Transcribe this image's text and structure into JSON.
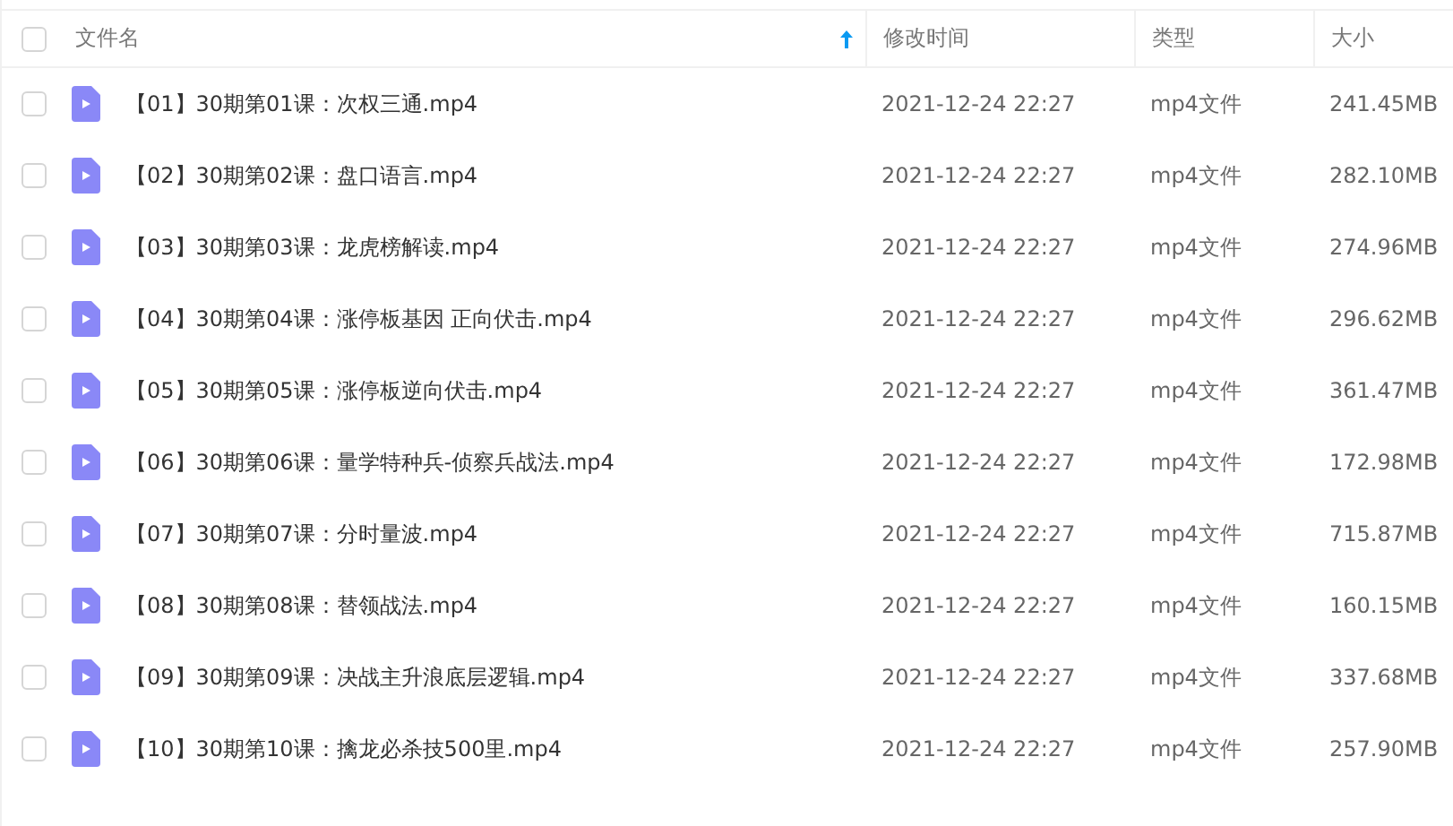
{
  "table": {
    "select_all": {
      "checked": false
    },
    "columns": [
      {
        "label": "文件名",
        "sorted": true
      },
      {
        "label": "修改时间",
        "sorted": false
      },
      {
        "label": "类型",
        "sorted": false
      },
      {
        "label": "大小",
        "sorted": false
      }
    ],
    "rows": [
      {
        "checked": false,
        "name": "【01】30期第01课：次权三通.mp4",
        "modified": "2021-12-24 22:27",
        "type": "mp4文件",
        "size": "241.45MB"
      },
      {
        "checked": false,
        "name": "【02】30期第02课：盘口语言.mp4",
        "modified": "2021-12-24 22:27",
        "type": "mp4文件",
        "size": "282.10MB"
      },
      {
        "checked": false,
        "name": "【03】30期第03课：龙虎榜解读.mp4",
        "modified": "2021-12-24 22:27",
        "type": "mp4文件",
        "size": "274.96MB"
      },
      {
        "checked": false,
        "name": "【04】30期第04课：涨停板基因 正向伏击.mp4",
        "modified": "2021-12-24 22:27",
        "type": "mp4文件",
        "size": "296.62MB"
      },
      {
        "checked": false,
        "name": "【05】30期第05课：涨停板逆向伏击.mp4",
        "modified": "2021-12-24 22:27",
        "type": "mp4文件",
        "size": "361.47MB"
      },
      {
        "checked": false,
        "name": "【06】30期第06课：量学特种兵-侦察兵战法.mp4",
        "modified": "2021-12-24 22:27",
        "type": "mp4文件",
        "size": "172.98MB"
      },
      {
        "checked": false,
        "name": "【07】30期第07课：分时量波.mp4",
        "modified": "2021-12-24 22:27",
        "type": "mp4文件",
        "size": "715.87MB"
      },
      {
        "checked": false,
        "name": "【08】30期第08课：替领战法.mp4",
        "modified": "2021-12-24 22:27",
        "type": "mp4文件",
        "size": "160.15MB"
      },
      {
        "checked": false,
        "name": "【09】30期第09课：决战主升浪底层逻辑.mp4",
        "modified": "2021-12-24 22:27",
        "type": "mp4文件",
        "size": "337.68MB"
      },
      {
        "checked": false,
        "name": "【10】30期第10课：擒龙必杀技500里.mp4",
        "modified": "2021-12-24 22:27",
        "type": "mp4文件",
        "size": "257.90MB"
      }
    ]
  }
}
